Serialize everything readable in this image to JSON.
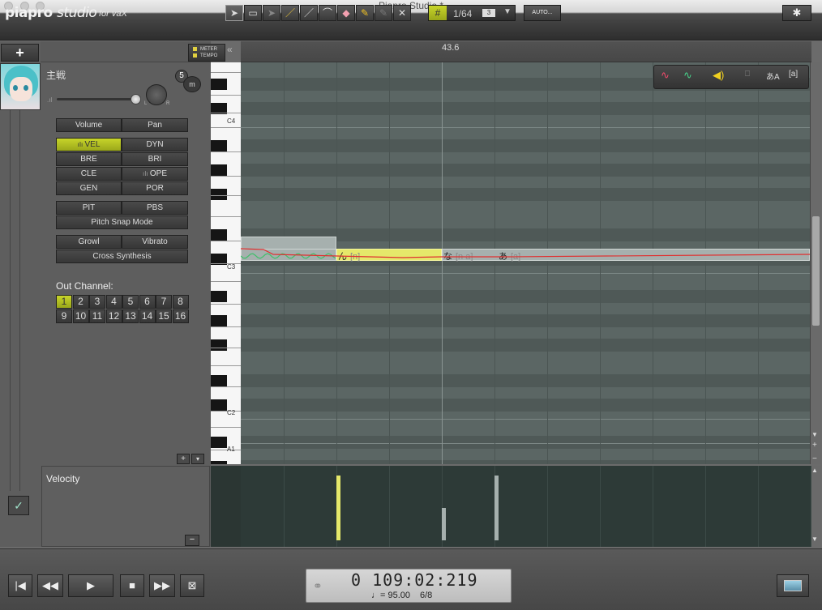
{
  "window": {
    "title": "Piapro Studio *"
  },
  "toolbar": {
    "logo": "piapro",
    "logo_studio": "studio",
    "logo_sub": "for vaX",
    "snap_value": "1/64",
    "snap_mode": "3",
    "auto_label": "AUTO...",
    "tools": [
      "select-icon",
      "select-range-icon",
      "select-alt-icon",
      "pencil-icon",
      "line-icon",
      "curve-icon",
      "eraser-icon",
      "highlighter-icon",
      "pen-disabled-icon",
      "delete-icon"
    ]
  },
  "track": {
    "name": "主戦",
    "number": "5",
    "meter_label": "METER",
    "tempo_label": "TEMPO",
    "add_label": "+"
  },
  "params": {
    "volume": "Volume",
    "pan": "Pan",
    "vel": "VEL",
    "dyn": "DYN",
    "bre": "BRE",
    "bri": "BRI",
    "cle": "CLE",
    "ope": "OPE",
    "gen": "GEN",
    "por": "POR",
    "pit": "PIT",
    "pbs": "PBS",
    "pitch_snap": "Pitch Snap Mode",
    "growl": "Growl",
    "vibrato": "Vibrato",
    "cross": "Cross Synthesis"
  },
  "out_channel": {
    "label": "Out Channel:",
    "channels": [
      "1",
      "2",
      "3",
      "4",
      "5",
      "6",
      "7",
      "8",
      "9",
      "10",
      "11",
      "12",
      "13",
      "14",
      "15",
      "16"
    ],
    "selected": "1"
  },
  "ruler": {
    "marker": "43.6"
  },
  "piano": {
    "labels": [
      "C4",
      "C3",
      "C2",
      "A1"
    ]
  },
  "notes": [
    {
      "lyric": "ん",
      "phoneme": "[n]"
    },
    {
      "lyric": "な",
      "phoneme": "[n a]"
    },
    {
      "lyric": "あ",
      "phoneme": "[a]"
    }
  ],
  "velocity": {
    "label": "Velocity",
    "values": [
      0.8,
      0.4,
      0.8
    ]
  },
  "transport": {
    "time": "0 109:02:219",
    "tempo": "♩= 95.00",
    "signature": "6/8"
  }
}
